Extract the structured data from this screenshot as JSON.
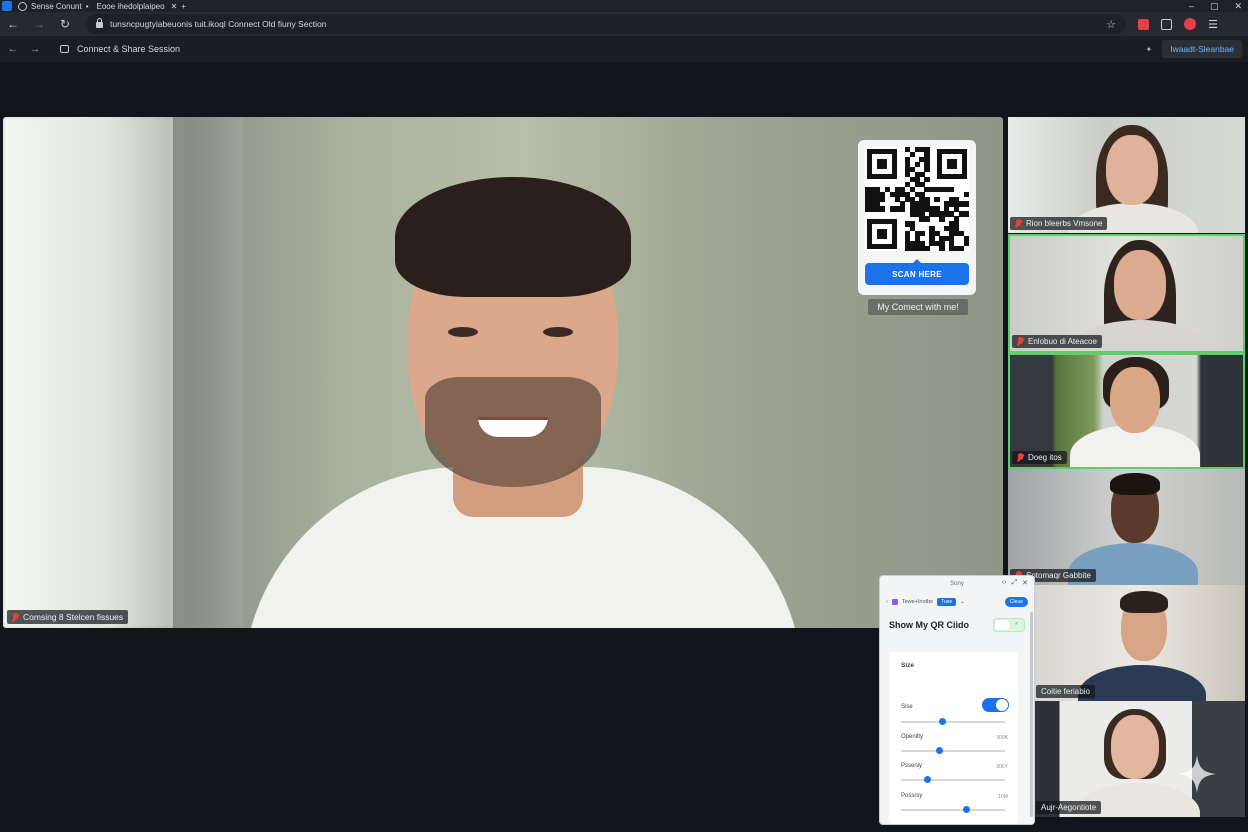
{
  "browser": {
    "tab_title": "Sense Conunt",
    "tab_subtitle": "Eooe ihedolplaipeo",
    "url": "tunsncpugtyiabeuonis tuit.ikoql Connect Old fiuny Section",
    "window_controls": [
      "–",
      "▢",
      "✕"
    ]
  },
  "page_header": {
    "title": "Connect & Share Session",
    "action_label": "Iwaadt-Sleanbae"
  },
  "main_video": {
    "participant_name": "Comsing 8 Stelcen fissues",
    "mic_muted": true
  },
  "qr_overlay": {
    "button_label": "SCAN HERE",
    "caption": "My Comect with me!"
  },
  "participants": [
    {
      "name": "Rion bleerbs Vmsone",
      "active": false
    },
    {
      "name": "Enlobuo di Ateacoe",
      "active": true
    },
    {
      "name": "Doeg itos",
      "active": true
    },
    {
      "name": "Sotomaqr Gabbite",
      "active": false
    },
    {
      "name": "Coitie feriabio",
      "active": false
    },
    {
      "name": "Aujr-Aegontiote",
      "active": false
    }
  ],
  "qr_settings_popup": {
    "window_title": "Sony",
    "nav_text": "Tewe+Inotbe",
    "nav_chip": "Tuse",
    "nav_button": "Cleue",
    "title": "Show My QR Ciido",
    "section_title": "Size",
    "rows": [
      {
        "label": "Sise",
        "type": "toggle",
        "value": true,
        "slider": 0.4
      },
      {
        "label": "Openilty",
        "value_text": "300K",
        "slider": 0.37
      },
      {
        "label": "Psseniy",
        "value_text": "300Y",
        "slider": 0.25
      },
      {
        "label": "Possrsy",
        "value_text": "10M",
        "slider": 0.63
      }
    ]
  }
}
